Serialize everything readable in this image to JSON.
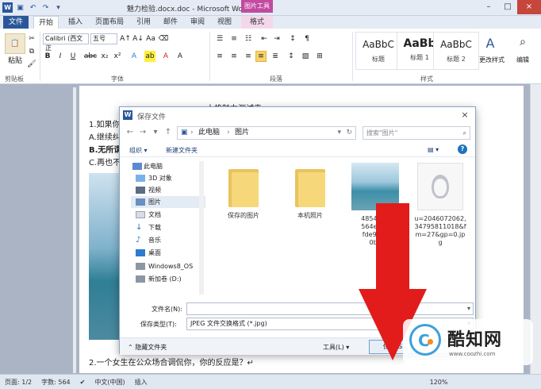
{
  "app": {
    "title": "魅力检验.docx.doc - Microsoft Word",
    "picture_tools": "图片工具",
    "window_controls": [
      "–",
      "□",
      "×"
    ]
  },
  "ribbon_tabs": [
    "文件",
    "开始",
    "插入",
    "页面布局",
    "引用",
    "邮件",
    "审阅",
    "视图",
    "格式"
  ],
  "ribbon": {
    "paste": "粘贴",
    "clipboard": "剪贴板",
    "font_name": "Calibri (西文正",
    "font_size": "五号",
    "font_group": "字体",
    "paragraph_group": "段落",
    "styles_group": "样式",
    "styles": [
      {
        "sample": "AaBbC",
        "name": "标题"
      },
      {
        "sample": "AaBb",
        "name": "标题 1"
      },
      {
        "sample": "AaBbC",
        "name": "标题 2"
      }
    ],
    "change_styles": "更改样式",
    "edit": "编辑"
  },
  "document": {
    "heading": "人格魅力测试表",
    "lines": [
      "1.如果你",
      "A.继续纠",
      "B.无所谓",
      "C.再也不"
    ],
    "bottom_line": "2.一个女生在公众场合调侃你，你的反应是？↵"
  },
  "dialog": {
    "title": "保存文件",
    "close": "×",
    "breadcrumb": [
      "此电脑",
      "图片"
    ],
    "search_placeholder": "搜索\"图片\"",
    "organize": "组织 ▾",
    "new_folder": "新建文件夹",
    "help": "?",
    "nav_items": [
      "此电脑",
      "3D 对象",
      "视频",
      "图片",
      "文档",
      "下载",
      "音乐",
      "桌面",
      "Windows8_OS",
      "新加卷 (D:)"
    ],
    "files": [
      {
        "label": "保存的图片",
        "kind": "folder"
      },
      {
        "label": "本机照片",
        "kind": "folder"
      },
      {
        "label": "4854092\n564e081\nfde9c82\n0b.j",
        "kind": "photo"
      },
      {
        "label": "u=2046072062,\n34795811018&f\nm=27&gp=0.jp\ng",
        "kind": "ring"
      }
    ],
    "filename_label": "文件名(N):",
    "filename_value": "",
    "filetype_label": "保存类型(T):",
    "filetype_value": "JPEG 文件交换格式 (*.jpg)",
    "hide_folders": "隐藏文件夹",
    "tools": "工具(L)",
    "save": "保存(S",
    "cancel": ""
  },
  "statusbar": {
    "page": "页面: 1/2",
    "words": "字数: 564",
    "language": "中文(中国)",
    "insert": "插入",
    "zoom": "120%"
  },
  "watermark": {
    "brand": "酷知网",
    "url": "www.coozhi.com"
  },
  "colors": {
    "word_blue": "#2b579a",
    "picture_tools": "#c24aa0",
    "arrow_red": "#e21b1b",
    "watermark_blue": "#3ca1dc",
    "watermark_orange": "#f28c1c"
  }
}
